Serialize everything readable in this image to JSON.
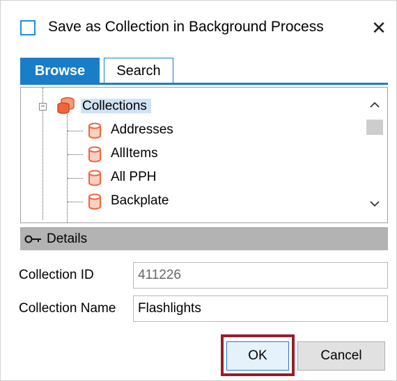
{
  "window": {
    "title": "Save as Collection in Background Process",
    "close_glyph": "✕"
  },
  "tabs": [
    {
      "label": "Browse",
      "active": true
    },
    {
      "label": "Search",
      "active": false
    }
  ],
  "tree": {
    "root": {
      "label": "Collections",
      "expander": "−",
      "icon": "database-stack-icon"
    },
    "children": [
      {
        "label": "Addresses",
        "icon": "database-icon"
      },
      {
        "label": "AllItems",
        "icon": "database-icon"
      },
      {
        "label": "All PPH",
        "icon": "database-icon"
      },
      {
        "label": "Backplate",
        "icon": "database-icon"
      }
    ],
    "scroll_up_glyph": "^",
    "scroll_down_glyph": "v"
  },
  "details": {
    "label": "Details",
    "icon": "key-icon"
  },
  "fields": {
    "collection_id": {
      "label": "Collection ID",
      "value": "411226"
    },
    "collection_name": {
      "label": "Collection Name",
      "value": "Flashlights"
    }
  },
  "buttons": {
    "ok": "OK",
    "cancel": "Cancel"
  },
  "colors": {
    "accent": "#1a7dc8",
    "highlight_outline": "#9b1c2a",
    "db_icon": "#f0643c",
    "selection": "#cfe3f5",
    "details_bar": "#b3b3b3"
  }
}
